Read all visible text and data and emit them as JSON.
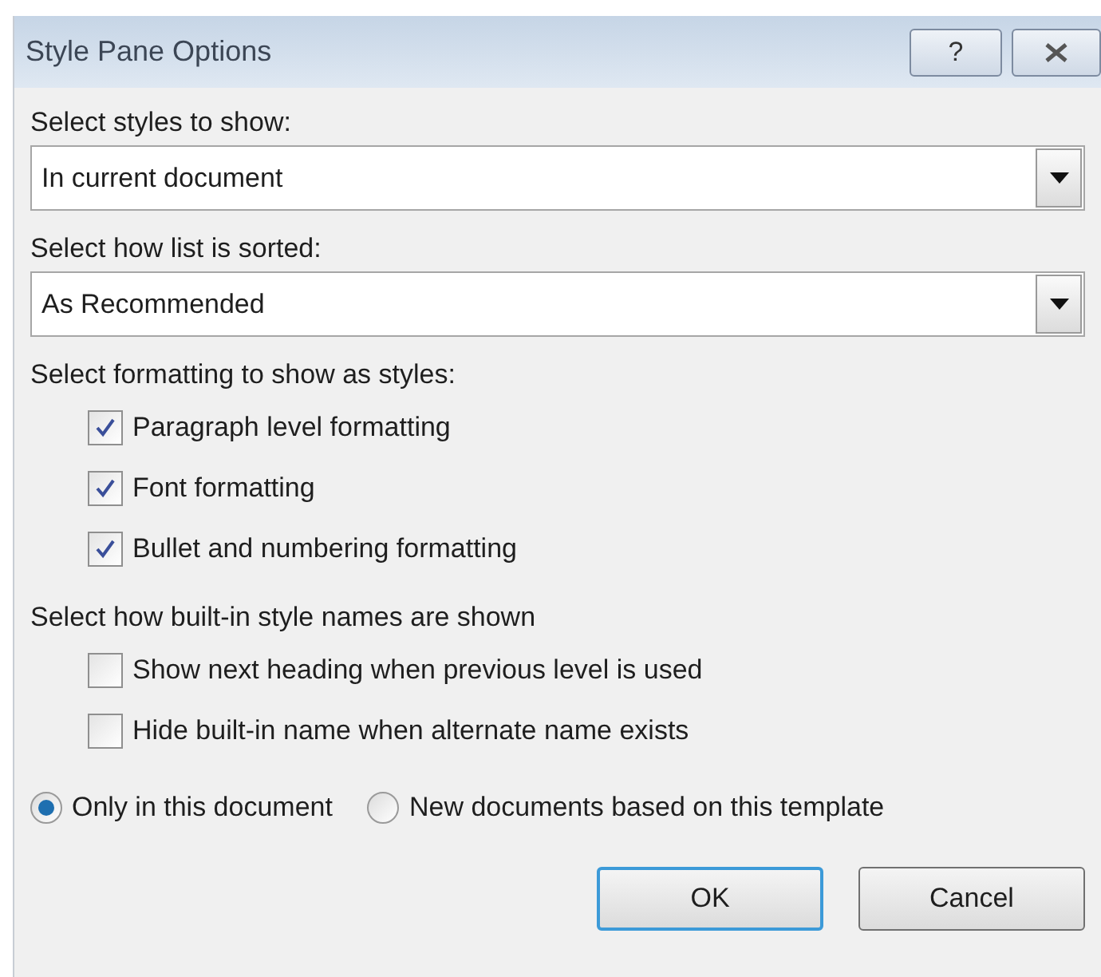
{
  "window": {
    "title": "Style Pane Options",
    "help_button": "?"
  },
  "dropdowns": [
    {
      "label": "Select styles to show:",
      "value": "In current document"
    },
    {
      "label": "Select how list is sorted:",
      "value": "As Recommended"
    }
  ],
  "formatting": {
    "label": "Select formatting to show as styles:",
    "options": [
      {
        "label": "Paragraph level formatting",
        "checked": true
      },
      {
        "label": "Font formatting",
        "checked": true
      },
      {
        "label": "Bullet and numbering formatting",
        "checked": true
      }
    ]
  },
  "names": {
    "label": "Select how built-in style names are shown",
    "options": [
      {
        "label": "Show next heading when previous level is used",
        "checked": false
      },
      {
        "label": "Hide built-in name when alternate name exists",
        "checked": false
      }
    ]
  },
  "scope": [
    {
      "label": "Only in this document",
      "selected": true
    },
    {
      "label": "New documents based on this template",
      "selected": false
    }
  ],
  "buttons": [
    {
      "label": "OK",
      "default": true
    },
    {
      "label": "Cancel",
      "default": false
    }
  ]
}
